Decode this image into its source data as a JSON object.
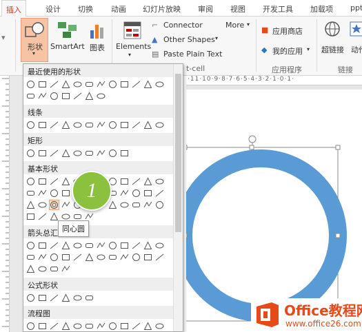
{
  "tabs": [
    "插入",
    "设计",
    "切换",
    "动画",
    "幻灯片放映",
    "审阅",
    "视图",
    "开发工具",
    "加载项",
    "ppt"
  ],
  "active_tab": "插入",
  "ribbon": {
    "shapes_label": "形状",
    "smartart_label": "SmartArt",
    "chart_label": "图表",
    "elements_label": "Elements",
    "connector_label": "Connector",
    "other_shapes_label": "Other Shapes",
    "paste_plain_text_label": "Paste Plain Text",
    "more_label": "More",
    "app_store_label": "应用商店",
    "my_apps_label": "我的应用",
    "hyperlink_label": "超链接",
    "action_label": "动作",
    "group_apps_label": "应用程序",
    "group_links_label": "链接",
    "group_partial_label": "t-cell"
  },
  "ruler": {
    "ticks_text": "·11·10·9·8·7·6·5·4·3·2·1·0·1·"
  },
  "panel": {
    "sections": [
      "最近使用的形状",
      "线条",
      "矩形",
      "基本形状",
      "箭头总汇",
      "公式形状",
      "流程图"
    ],
    "tooltip": "同心圆"
  },
  "callout_number": "1",
  "watermark": {
    "brand": "Office教程网",
    "url": "www.office26.com"
  },
  "colors": {
    "accent": "#c43e1c",
    "ring": "#5b9bd5",
    "callout": "#8cc13f"
  }
}
